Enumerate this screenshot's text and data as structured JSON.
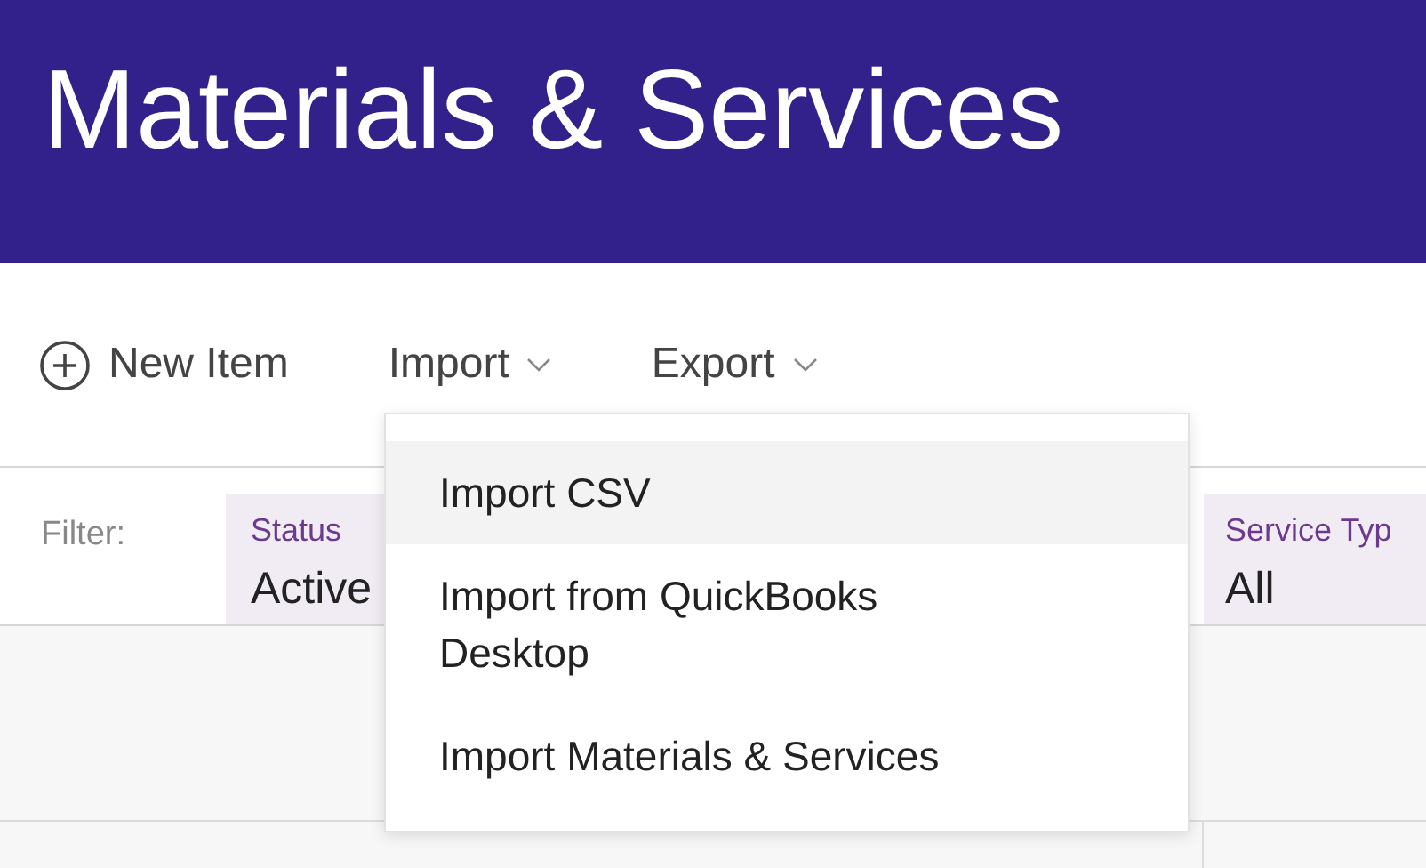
{
  "header": {
    "title": "Materials & Services"
  },
  "toolbar": {
    "items": [
      {
        "kind": "add",
        "label": "New Item"
      },
      {
        "kind": "menu",
        "label": "Import",
        "menu": [
          {
            "label": "Import CSV",
            "selected": true
          },
          {
            "label": "Import from QuickBooks Desktop",
            "selected": false
          },
          {
            "label": "Import Materials & Services",
            "selected": false
          }
        ]
      },
      {
        "kind": "menu",
        "label": "Export"
      }
    ]
  },
  "filter": {
    "label": "Filter:",
    "fields": [
      {
        "label": "Status",
        "value": "Active"
      },
      {
        "label": "Service Typ",
        "value": "All"
      }
    ]
  }
}
